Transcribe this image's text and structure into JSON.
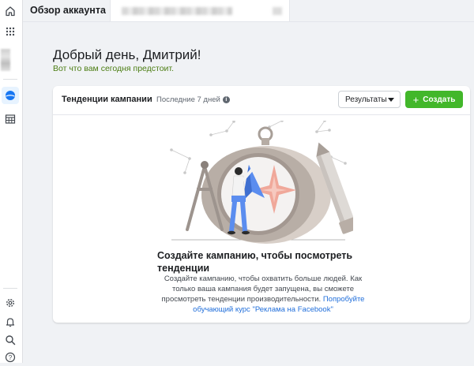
{
  "header": {
    "title": "Обзор аккаунта"
  },
  "sidebar": {
    "items": [
      {
        "icon": "home-icon"
      },
      {
        "icon": "apps-grid-icon"
      },
      {
        "icon": "account-overview-icon",
        "active": true
      },
      {
        "icon": "table-icon"
      },
      {
        "icon": "gear-icon"
      },
      {
        "icon": "bell-icon"
      },
      {
        "icon": "search-icon"
      },
      {
        "icon": "help-icon"
      }
    ]
  },
  "main": {
    "greeting": "Добрый день, Дмитрий!",
    "subgreeting": "Вот что вам сегодня предстоит."
  },
  "card": {
    "title": "Тенденции кампании",
    "period": "Последние 7 дней",
    "results_label": "Результаты",
    "create_label": "Создать",
    "empty_title": "Создайте кампанию, чтобы посмотреть тенденции",
    "empty_desc": "Создайте кампанию, чтобы охватить больше людей. Как только ваша кампания будет запущена, вы сможете просмотреть тенденции производительности.",
    "link_text": "Попробуйте обучающий курс \"Реклама на Facebook\""
  },
  "colors": {
    "accent_blue": "#1877f2",
    "create_green": "#42b72a",
    "subgreeting_green": "#4b7d12",
    "link_blue": "#216fdb",
    "background": "#f0f2f5"
  }
}
